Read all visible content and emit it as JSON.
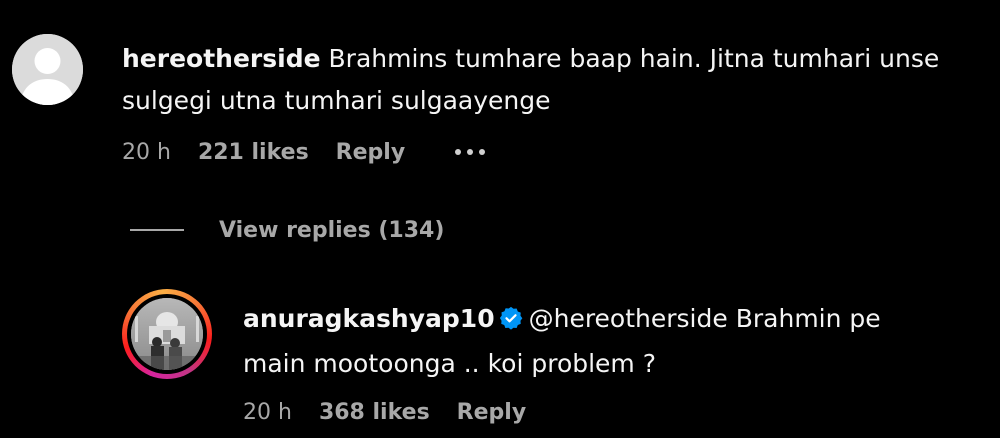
{
  "comment": {
    "username": "hereotherside",
    "text": "Brahmins tumhare baap hain. Jitna tumhari unse sulgegi utna tumhari sulgaayenge",
    "time": "20 h",
    "likes": "221 likes",
    "reply_label": "Reply",
    "avatar_icon": "default-avatar-icon",
    "more_icon": "more-options-icon"
  },
  "view_replies": {
    "label": "View replies (134)"
  },
  "reply": {
    "username": "anuragkashyap10",
    "verified_icon": "verified-badge-icon",
    "mention": "@hereotherside",
    "text": "Brahmin pe main mootoonga .. koi problem ?",
    "time": "20 h",
    "likes": "368 likes",
    "reply_label": "Reply"
  },
  "colors": {
    "background": "#000000",
    "primary_text": "#f5f5f5",
    "secondary_text": "#a8a8a8",
    "verified_blue": "#0095f6"
  }
}
